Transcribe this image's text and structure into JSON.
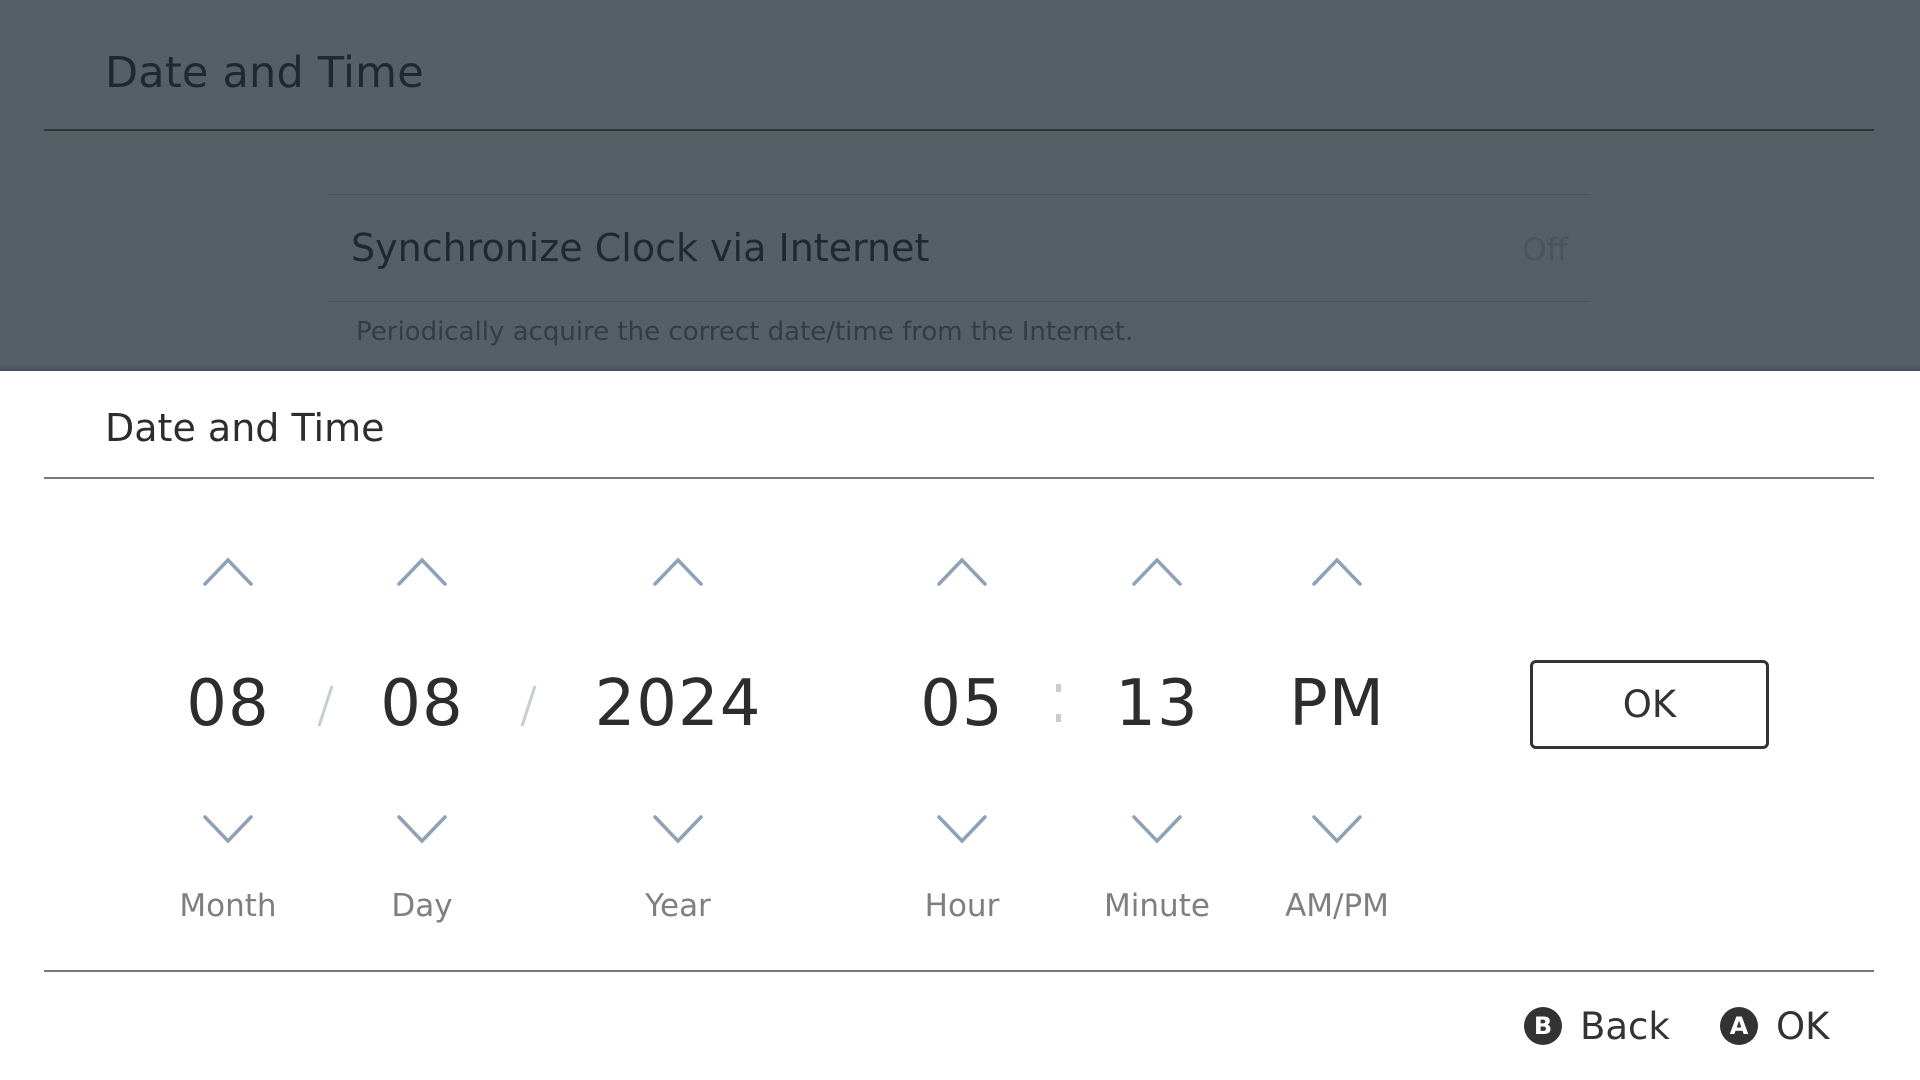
{
  "background_page": {
    "title": "Date and Time",
    "setting": {
      "label": "Synchronize Clock via Internet",
      "value": "Off",
      "description": "Periodically acquire the correct date/time from the Internet."
    }
  },
  "dialog": {
    "title": "Date and Time",
    "fields": [
      {
        "key": "month",
        "value": "08",
        "label": "Month"
      },
      {
        "key": "day",
        "value": "08",
        "label": "Day"
      },
      {
        "key": "year",
        "value": "2024",
        "label": "Year"
      },
      {
        "key": "hour",
        "value": "05",
        "label": "Hour"
      },
      {
        "key": "minute",
        "value": "13",
        "label": "Minute"
      },
      {
        "key": "ampm",
        "value": "PM",
        "label": "AM/PM"
      }
    ],
    "date_separator": "/",
    "time_separator": ":",
    "ok_button_label": "OK"
  },
  "footer": {
    "hints": [
      {
        "button": "B",
        "label": "Back"
      },
      {
        "button": "A",
        "label": "OK"
      }
    ]
  },
  "colors": {
    "backdrop": "#555f66",
    "chevron": "#8fa1b5",
    "text": "#2d2d2d",
    "label": "#7f7f7f",
    "separator": "#c8cdcd"
  }
}
